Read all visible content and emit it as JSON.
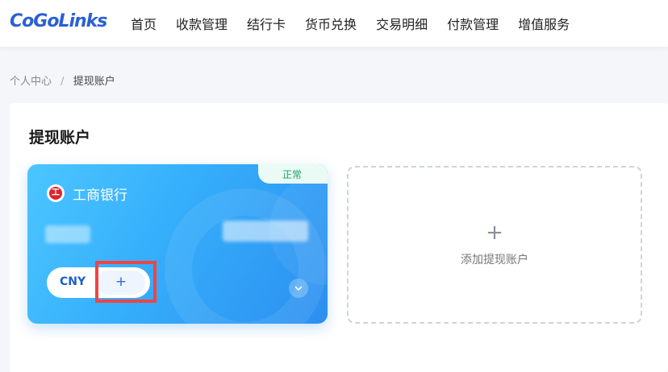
{
  "header": {
    "logo_text": "CoGoLinks",
    "nav": [
      "首页",
      "收款管理",
      "结行卡",
      "货币兑换",
      "交易明细",
      "付款管理",
      "增值服务"
    ]
  },
  "breadcrumb": {
    "parent": "个人中心",
    "separator": "/",
    "current": "提现账户"
  },
  "panel": {
    "title": "提现账户",
    "bank_card": {
      "status": "正常",
      "bank_name": "工商银行",
      "currency": "CNY",
      "add_label": "+"
    },
    "add_account": {
      "plus": "+",
      "label": "添加提现账户"
    }
  },
  "colors": {
    "brand": "#2b5fd6",
    "card_start": "#4cc6ff",
    "card_end": "#2c8ff0",
    "highlight": "#ef4444",
    "status": "#1aa06b"
  }
}
